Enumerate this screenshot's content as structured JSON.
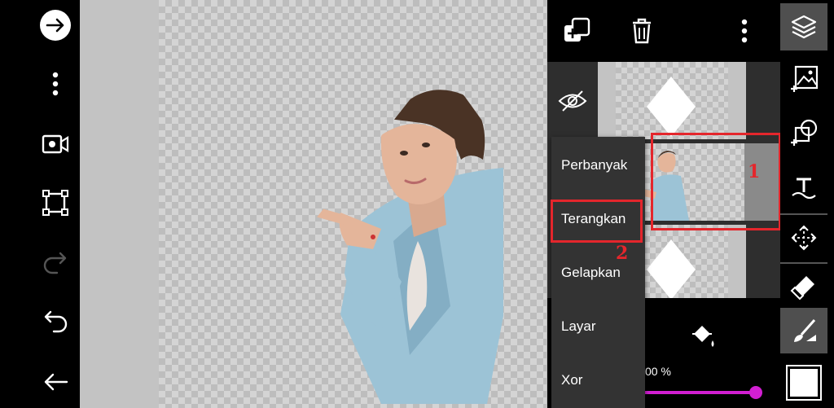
{
  "blend_menu": {
    "items": [
      {
        "label": "Perbanyak"
      },
      {
        "label": "Terangkan"
      },
      {
        "label": "Gelapkan"
      },
      {
        "label": "Layar"
      },
      {
        "label": "Xor"
      }
    ]
  },
  "opacity": {
    "label": "00 %",
    "value": 1.0
  },
  "annotations": {
    "marker_1": "1",
    "marker_2": "2"
  },
  "colors": {
    "accent_slider": "#d21fd2",
    "highlight": "#e4262c"
  },
  "icons": {
    "left": [
      "arrow-right-circle-icon",
      "more-vertical-icon",
      "video-camera-icon",
      "crop-frame-icon",
      "redo-icon",
      "undo-icon",
      "back-arrow-icon"
    ],
    "layers_top": [
      "add-layer-icon",
      "trash-icon",
      "more-vertical-icon"
    ],
    "right": [
      "layers-icon",
      "add-image-icon",
      "add-shape-icon",
      "text-icon",
      "move-icon",
      "eraser-icon",
      "brush-icon",
      "color-swatch-icon"
    ]
  }
}
